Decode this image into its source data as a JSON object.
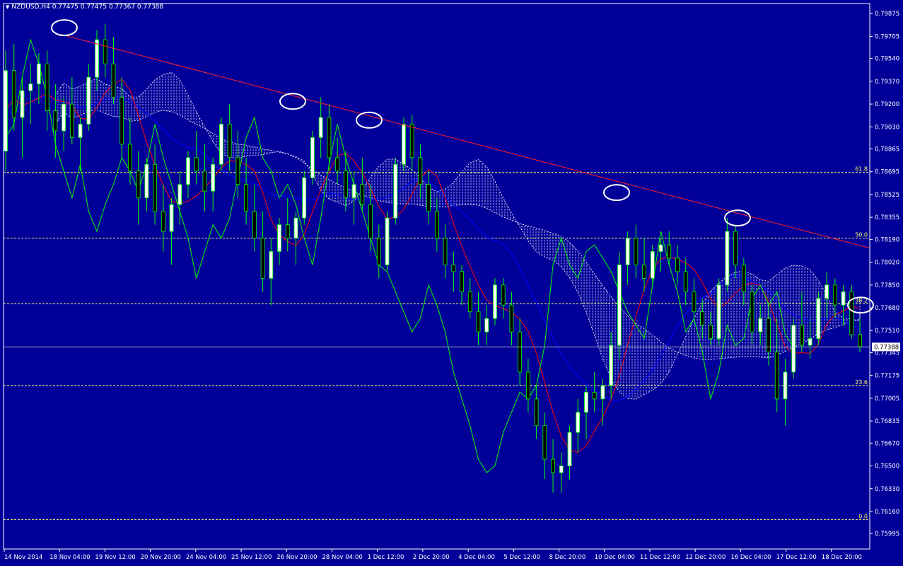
{
  "header": {
    "symbol": "NZDUSD,H4",
    "values": "0.77475 0.77475 0.77367 0.77388"
  },
  "colors": {
    "background": "#000099",
    "frame": "#ffffff",
    "candle_up_body": "#ffffff",
    "candle_down_body": "#000000",
    "wick": "#00ff00",
    "trendline": "#ff2020",
    "kijun": "#0000ff",
    "tenkan": "#ff0000",
    "chikou": "#00ff00",
    "cloud": "#ffffff",
    "fib": "#ffff66",
    "circle": "#ffffff"
  },
  "chart_data": {
    "type": "candlestick",
    "symbol": "NZDUSD",
    "timeframe": "H4",
    "ylim": [
      0.7588,
      0.7995
    ],
    "price_ticks": [
      "0.79875",
      "0.79705",
      "0.79540",
      "0.79370",
      "0.79200",
      "0.79030",
      "0.78865",
      "0.78695",
      "0.78525",
      "0.78355",
      "0.78190",
      "0.78020",
      "0.77850",
      "0.77680",
      "0.77510",
      "0.77345",
      "0.77175",
      "0.77005",
      "0.76835",
      "0.76670",
      "0.76500",
      "0.76330",
      "0.76160",
      "0.75995"
    ],
    "current_price": "0.77388",
    "time_labels": [
      "14 Nov 2014",
      "18 Nov 04:00",
      "19 Nov 12:00",
      "20 Nov 20:00",
      "24 Nov 04:00",
      "25 Nov 12:00",
      "26 Nov 20:00",
      "28 Nov 04:00",
      "1 Dec 12:00",
      "2 Dec 20:00",
      "4 Dec 04:00",
      "5 Dec 12:00",
      "8 Dec 20:00",
      "10 Dec 04:00",
      "11 Dec 12:00",
      "12 Dec 20:00",
      "16 Dec 04:00",
      "17 Dec 12:00",
      "18 Dec 20:00"
    ],
    "fib_levels": [
      {
        "label": "61.8",
        "price": 0.7869
      },
      {
        "label": "50.0",
        "price": 0.782
      },
      {
        "label": "38.2",
        "price": 0.7771
      },
      {
        "label": "23.6",
        "price": 0.771
      },
      {
        "label": "0.0",
        "price": 0.761
      }
    ],
    "trendline": {
      "from": [
        86,
        0.7972
      ],
      "to": [
        1277,
        0.7806
      ]
    },
    "highlight_points": [
      {
        "x": 91,
        "price": 0.7977
      },
      {
        "x": 414,
        "price": 0.7922
      },
      {
        "x": 522,
        "price": 0.7908
      },
      {
        "x": 872,
        "price": 0.7854
      },
      {
        "x": 1043,
        "price": 0.7835
      },
      {
        "x": 1217,
        "price": 0.777
      }
    ],
    "candles": [
      [
        0.7885,
        0.796,
        0.787,
        0.7945
      ],
      [
        0.7945,
        0.7965,
        0.79,
        0.791
      ],
      [
        0.791,
        0.794,
        0.788,
        0.793
      ],
      [
        0.793,
        0.795,
        0.7905,
        0.7935
      ],
      [
        0.7935,
        0.7958,
        0.792,
        0.795
      ],
      [
        0.795,
        0.796,
        0.79,
        0.7915
      ],
      [
        0.7915,
        0.7935,
        0.788,
        0.79
      ],
      [
        0.79,
        0.7925,
        0.7885,
        0.792
      ],
      [
        0.792,
        0.794,
        0.789,
        0.7895
      ],
      [
        0.7895,
        0.791,
        0.787,
        0.7905
      ],
      [
        0.7905,
        0.795,
        0.79,
        0.794
      ],
      [
        0.794,
        0.7975,
        0.793,
        0.7968
      ],
      [
        0.7968,
        0.798,
        0.794,
        0.795
      ],
      [
        0.795,
        0.797,
        0.792,
        0.7925
      ],
      [
        0.7925,
        0.794,
        0.788,
        0.789
      ],
      [
        0.789,
        0.791,
        0.786,
        0.787
      ],
      [
        0.787,
        0.7885,
        0.783,
        0.785
      ],
      [
        0.785,
        0.788,
        0.784,
        0.7875
      ],
      [
        0.7875,
        0.789,
        0.783,
        0.784
      ],
      [
        0.784,
        0.786,
        0.781,
        0.7825
      ],
      [
        0.7825,
        0.785,
        0.78,
        0.7845
      ],
      [
        0.7845,
        0.787,
        0.783,
        0.786
      ],
      [
        0.786,
        0.7885,
        0.785,
        0.788
      ],
      [
        0.788,
        0.79,
        0.786,
        0.787
      ],
      [
        0.787,
        0.789,
        0.784,
        0.7855
      ],
      [
        0.7855,
        0.788,
        0.784,
        0.7875
      ],
      [
        0.7875,
        0.791,
        0.787,
        0.7905
      ],
      [
        0.7905,
        0.792,
        0.787,
        0.788
      ],
      [
        0.788,
        0.79,
        0.785,
        0.786
      ],
      [
        0.786,
        0.788,
        0.783,
        0.784
      ],
      [
        0.784,
        0.786,
        0.781,
        0.782
      ],
      [
        0.782,
        0.784,
        0.778,
        0.779
      ],
      [
        0.779,
        0.782,
        0.777,
        0.781
      ],
      [
        0.781,
        0.7835,
        0.78,
        0.783
      ],
      [
        0.783,
        0.785,
        0.781,
        0.782
      ],
      [
        0.782,
        0.784,
        0.78,
        0.7835
      ],
      [
        0.7835,
        0.787,
        0.783,
        0.7865
      ],
      [
        0.7865,
        0.79,
        0.786,
        0.7895
      ],
      [
        0.7895,
        0.7925,
        0.788,
        0.791
      ],
      [
        0.791,
        0.792,
        0.787,
        0.788
      ],
      [
        0.788,
        0.7895,
        0.786,
        0.787
      ],
      [
        0.787,
        0.7885,
        0.784,
        0.785
      ],
      [
        0.785,
        0.787,
        0.783,
        0.786
      ],
      [
        0.786,
        0.788,
        0.784,
        0.7845
      ],
      [
        0.7845,
        0.786,
        0.781,
        0.782
      ],
      [
        0.782,
        0.783,
        0.779,
        0.78
      ],
      [
        0.78,
        0.784,
        0.7795,
        0.7835
      ],
      [
        0.7835,
        0.788,
        0.783,
        0.7875
      ],
      [
        0.7875,
        0.791,
        0.787,
        0.7905
      ],
      [
        0.7905,
        0.7912,
        0.787,
        0.788
      ],
      [
        0.788,
        0.789,
        0.785,
        0.786
      ],
      [
        0.786,
        0.787,
        0.783,
        0.784
      ],
      [
        0.784,
        0.785,
        0.781,
        0.782
      ],
      [
        0.782,
        0.783,
        0.779,
        0.78
      ],
      [
        0.78,
        0.781,
        0.778,
        0.7795
      ],
      [
        0.7795,
        0.78,
        0.777,
        0.778
      ],
      [
        0.778,
        0.779,
        0.776,
        0.7765
      ],
      [
        0.7765,
        0.778,
        0.774,
        0.775
      ],
      [
        0.775,
        0.777,
        0.774,
        0.776
      ],
      [
        0.776,
        0.779,
        0.7755,
        0.7785
      ],
      [
        0.7785,
        0.779,
        0.776,
        0.777
      ],
      [
        0.777,
        0.778,
        0.774,
        0.775
      ],
      [
        0.775,
        0.776,
        0.771,
        0.772
      ],
      [
        0.772,
        0.773,
        0.769,
        0.77
      ],
      [
        0.77,
        0.771,
        0.767,
        0.768
      ],
      [
        0.768,
        0.769,
        0.764,
        0.7655
      ],
      [
        0.7655,
        0.767,
        0.763,
        0.7645
      ],
      [
        0.7645,
        0.766,
        0.763,
        0.765
      ],
      [
        0.765,
        0.768,
        0.764,
        0.7675
      ],
      [
        0.7675,
        0.77,
        0.766,
        0.769
      ],
      [
        0.769,
        0.771,
        0.767,
        0.7705
      ],
      [
        0.7705,
        0.772,
        0.769,
        0.77
      ],
      [
        0.77,
        0.7715,
        0.768,
        0.771
      ],
      [
        0.771,
        0.775,
        0.77,
        0.774
      ],
      [
        0.774,
        0.781,
        0.773,
        0.78
      ],
      [
        0.78,
        0.7825,
        0.7785,
        0.782
      ],
      [
        0.782,
        0.783,
        0.779,
        0.78
      ],
      [
        0.78,
        0.782,
        0.778,
        0.779
      ],
      [
        0.779,
        0.7815,
        0.7785,
        0.781
      ],
      [
        0.781,
        0.782,
        0.7795,
        0.7815
      ],
      [
        0.7815,
        0.7825,
        0.78,
        0.7805
      ],
      [
        0.7805,
        0.7815,
        0.7785,
        0.7795
      ],
      [
        0.7795,
        0.7805,
        0.777,
        0.778
      ],
      [
        0.778,
        0.779,
        0.776,
        0.7765
      ],
      [
        0.7765,
        0.7775,
        0.7745,
        0.7755
      ],
      [
        0.7755,
        0.7765,
        0.774,
        0.7745
      ],
      [
        0.7745,
        0.779,
        0.774,
        0.7785
      ],
      [
        0.7785,
        0.7835,
        0.778,
        0.7825
      ],
      [
        0.7825,
        0.783,
        0.779,
        0.78
      ],
      [
        0.78,
        0.7805,
        0.777,
        0.778
      ],
      [
        0.778,
        0.7785,
        0.774,
        0.775
      ],
      [
        0.775,
        0.777,
        0.774,
        0.776
      ],
      [
        0.776,
        0.777,
        0.7725,
        0.7735
      ],
      [
        0.7735,
        0.776,
        0.769,
        0.77
      ],
      [
        0.77,
        0.773,
        0.768,
        0.772
      ],
      [
        0.772,
        0.776,
        0.7715,
        0.7755
      ],
      [
        0.7755,
        0.778,
        0.7735,
        0.774
      ],
      [
        0.774,
        0.776,
        0.773,
        0.7745
      ],
      [
        0.7745,
        0.778,
        0.774,
        0.7775
      ],
      [
        0.7775,
        0.7795,
        0.776,
        0.7785
      ],
      [
        0.7785,
        0.779,
        0.776,
        0.777
      ],
      [
        0.777,
        0.7785,
        0.7755,
        0.778
      ],
      [
        0.778,
        0.7785,
        0.7745,
        0.7748
      ],
      [
        0.7748,
        0.776,
        0.7735,
        0.7739
      ]
    ]
  }
}
